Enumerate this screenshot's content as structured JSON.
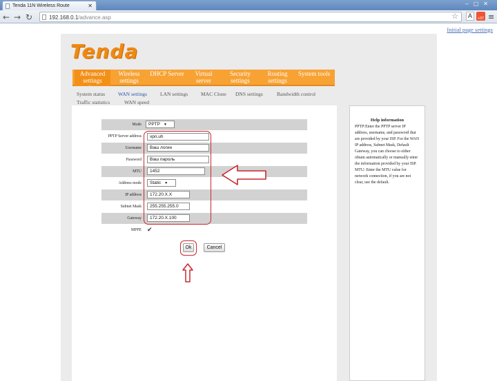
{
  "browser": {
    "tab_title": "Tenda 11N Wireless Route",
    "url_host": "192.168.0.1",
    "url_path": "/advance.asp",
    "ext_badge": "+37"
  },
  "top_link": "Initial page settings",
  "brand": "Tenda",
  "nav": [
    {
      "label": "Advanced settings"
    },
    {
      "label": "Wireless settings"
    },
    {
      "label": "DHCP Server"
    },
    {
      "label": "Virtual server"
    },
    {
      "label": "Security settings"
    },
    {
      "label": "Routing settings"
    },
    {
      "label": "System tools"
    }
  ],
  "subnav": [
    {
      "label": "System status"
    },
    {
      "label": "WAN settings"
    },
    {
      "label": "LAN settings"
    },
    {
      "label": "MAC Clone"
    },
    {
      "label": "DNS settings"
    },
    {
      "label": "Bandwidth control"
    },
    {
      "label": "Traffic statistics"
    },
    {
      "label": "WAN speed"
    }
  ],
  "form": {
    "mode": {
      "label": "Mode",
      "value": "PPTP"
    },
    "server": {
      "label": "PPTP Server address",
      "value": "vpn.uh"
    },
    "username": {
      "label": "Username",
      "value": "Ваш логин"
    },
    "password": {
      "label": "Password",
      "value": "Ваш пароль"
    },
    "mtu": {
      "label": "MTU",
      "value": "1452"
    },
    "address_mode": {
      "label": "Address mode",
      "value": "Static"
    },
    "ip": {
      "label": "IP address",
      "value": "172.20.X.X"
    },
    "mask": {
      "label": "Subnet Mask",
      "value": "255.255.255.0"
    },
    "gateway": {
      "label": "Gateway",
      "value": "172.20.X.100"
    },
    "mppe": {
      "label": "MPPE",
      "checked": true
    }
  },
  "buttons": {
    "ok": "Ok",
    "cancel": "Cancel"
  },
  "help": {
    "title": "Help information",
    "body": "PPTP:Enter the PPTP server IP address, username, and password that are provided by your ISP. For the WAN IP address, Subnet Mask, Default Gateway, you can choose to either obtain automatically or manually enter the information provided by your ISP. MTU: Enter the MTU value for network connection, if you are not clear, use the default."
  },
  "colors": {
    "accent": "#f7a233",
    "annotation": "#c9262b",
    "link": "#2c54a7"
  }
}
